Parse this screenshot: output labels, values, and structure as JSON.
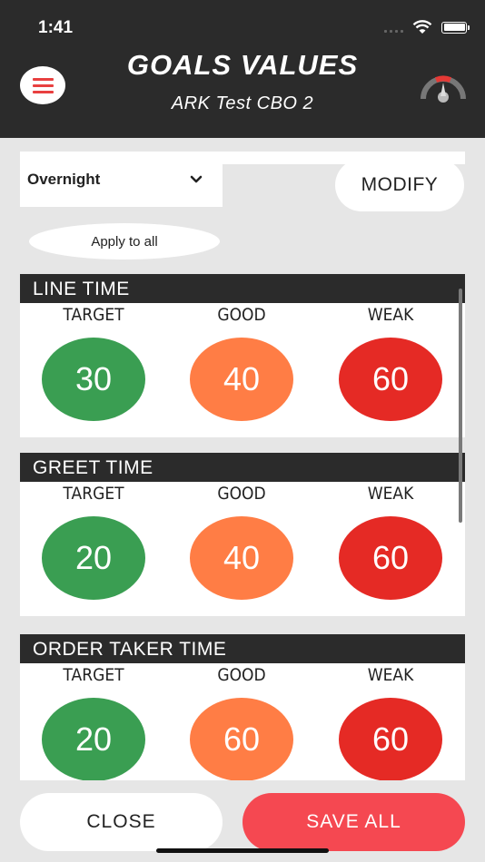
{
  "status_bar": {
    "time": "1:41"
  },
  "header": {
    "title": "GOALS VALUES",
    "subtitle": "ARK Test CBO 2"
  },
  "icons": {
    "menu": "hamburger-icon",
    "gauge": "speedometer-icon",
    "select": "chevron-down-icon"
  },
  "controls": {
    "period": "Overnight",
    "modify_label": "MODIFY",
    "apply_label": "Apply to all"
  },
  "colors": {
    "target": "#3a9e52",
    "good": "#ff7d45",
    "weak": "#e52a25",
    "save": "#f54851",
    "header": "#2b2b2b"
  },
  "sections": [
    {
      "title": "LINE TIME",
      "target_label": "TARGET",
      "good_label": "GOOD",
      "weak_label": "WEAK",
      "target": "30",
      "good": "40",
      "weak": "60"
    },
    {
      "title": "GREET TIME",
      "target_label": "TARGET",
      "good_label": "GOOD",
      "weak_label": "WEAK",
      "target": "20",
      "good": "40",
      "weak": "60"
    },
    {
      "title": "ORDER TAKER TIME",
      "target_label": "TARGET",
      "good_label": "GOOD",
      "weak_label": "WEAK",
      "target": "20",
      "good": "60",
      "weak": "60"
    }
  ],
  "footer": {
    "close_label": "CLOSE",
    "save_label": "SAVE ALL"
  }
}
